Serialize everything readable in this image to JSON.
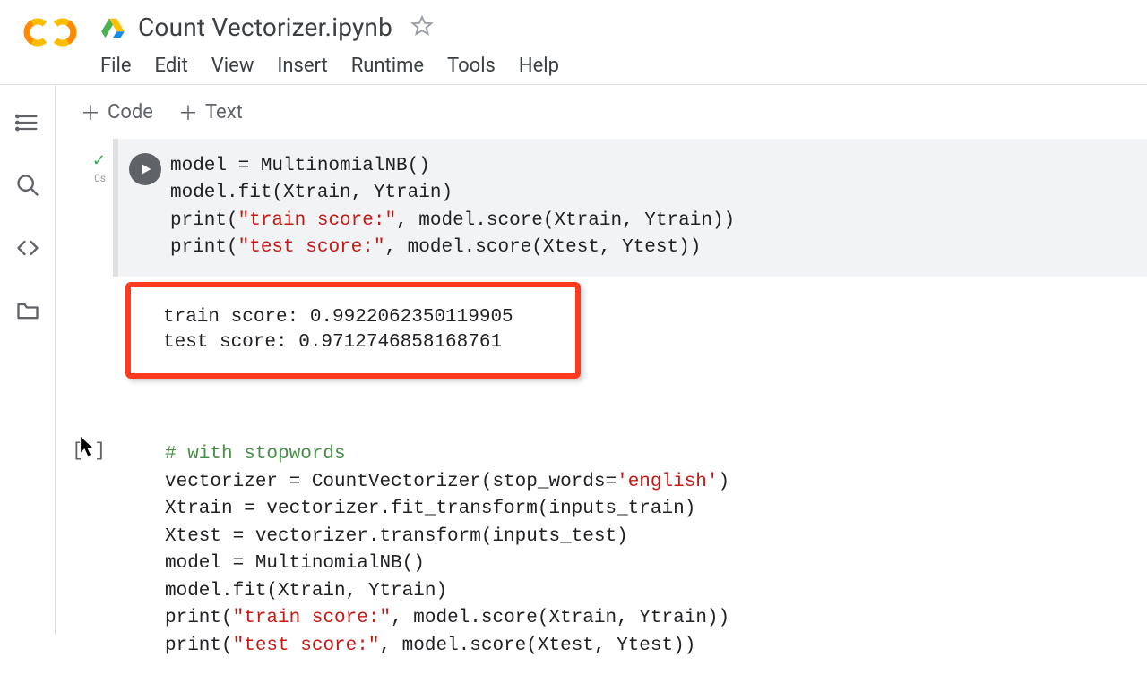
{
  "header": {
    "title": "Count Vectorizer.ipynb"
  },
  "menus": [
    "File",
    "Edit",
    "View",
    "Insert",
    "Runtime",
    "Tools",
    "Help"
  ],
  "toolbar": {
    "code_label": "Code",
    "text_label": "Text"
  },
  "gutter": {
    "exec_time": "0s"
  },
  "cells": {
    "c1": {
      "code_tokens": [
        {
          "t": "model = MultinomialNB()"
        },
        {
          "nl": true
        },
        {
          "t": "model.fit(Xtrain, Ytrain)"
        },
        {
          "nl": true
        },
        {
          "t": "print",
          "cls": ""
        },
        {
          "t": "(",
          "cls": ""
        },
        {
          "t": "\"train score:\"",
          "cls": "s-str"
        },
        {
          "t": ", model.score(Xtrain, Ytrain))"
        },
        {
          "nl": true
        },
        {
          "t": "print",
          "cls": ""
        },
        {
          "t": "(",
          "cls": ""
        },
        {
          "t": "\"test score:\"",
          "cls": "s-str"
        },
        {
          "t": ", model.score(Xtest, Ytest))"
        }
      ],
      "output_lines": [
        "train score: 0.9922062350119905",
        "test score: 0.9712746858168761"
      ]
    },
    "c2": {
      "prompt": "[ ]",
      "code_tokens": [
        {
          "t": "# with stopwords",
          "cls": "s-cmt"
        },
        {
          "nl": true
        },
        {
          "t": "vectorizer = CountVectorizer(stop_words="
        },
        {
          "t": "'english'",
          "cls": "s-str"
        },
        {
          "t": ")"
        },
        {
          "nl": true
        },
        {
          "t": "Xtrain = vectorizer.fit_transform(inputs_train)"
        },
        {
          "nl": true
        },
        {
          "t": "Xtest = vectorizer.transform(inputs_test)"
        },
        {
          "nl": true
        },
        {
          "t": "model = MultinomialNB()"
        },
        {
          "nl": true
        },
        {
          "t": "model.fit(Xtrain, Ytrain)"
        },
        {
          "nl": true
        },
        {
          "t": "print"
        },
        {
          "t": "("
        },
        {
          "t": "\"train score:\"",
          "cls": "s-str"
        },
        {
          "t": ", model.score(Xtrain, Ytrain))"
        },
        {
          "nl": true
        },
        {
          "t": "print"
        },
        {
          "t": "("
        },
        {
          "t": "\"test score:\"",
          "cls": "s-str"
        },
        {
          "t": ", model.score(Xtest, Ytest))"
        }
      ]
    }
  }
}
